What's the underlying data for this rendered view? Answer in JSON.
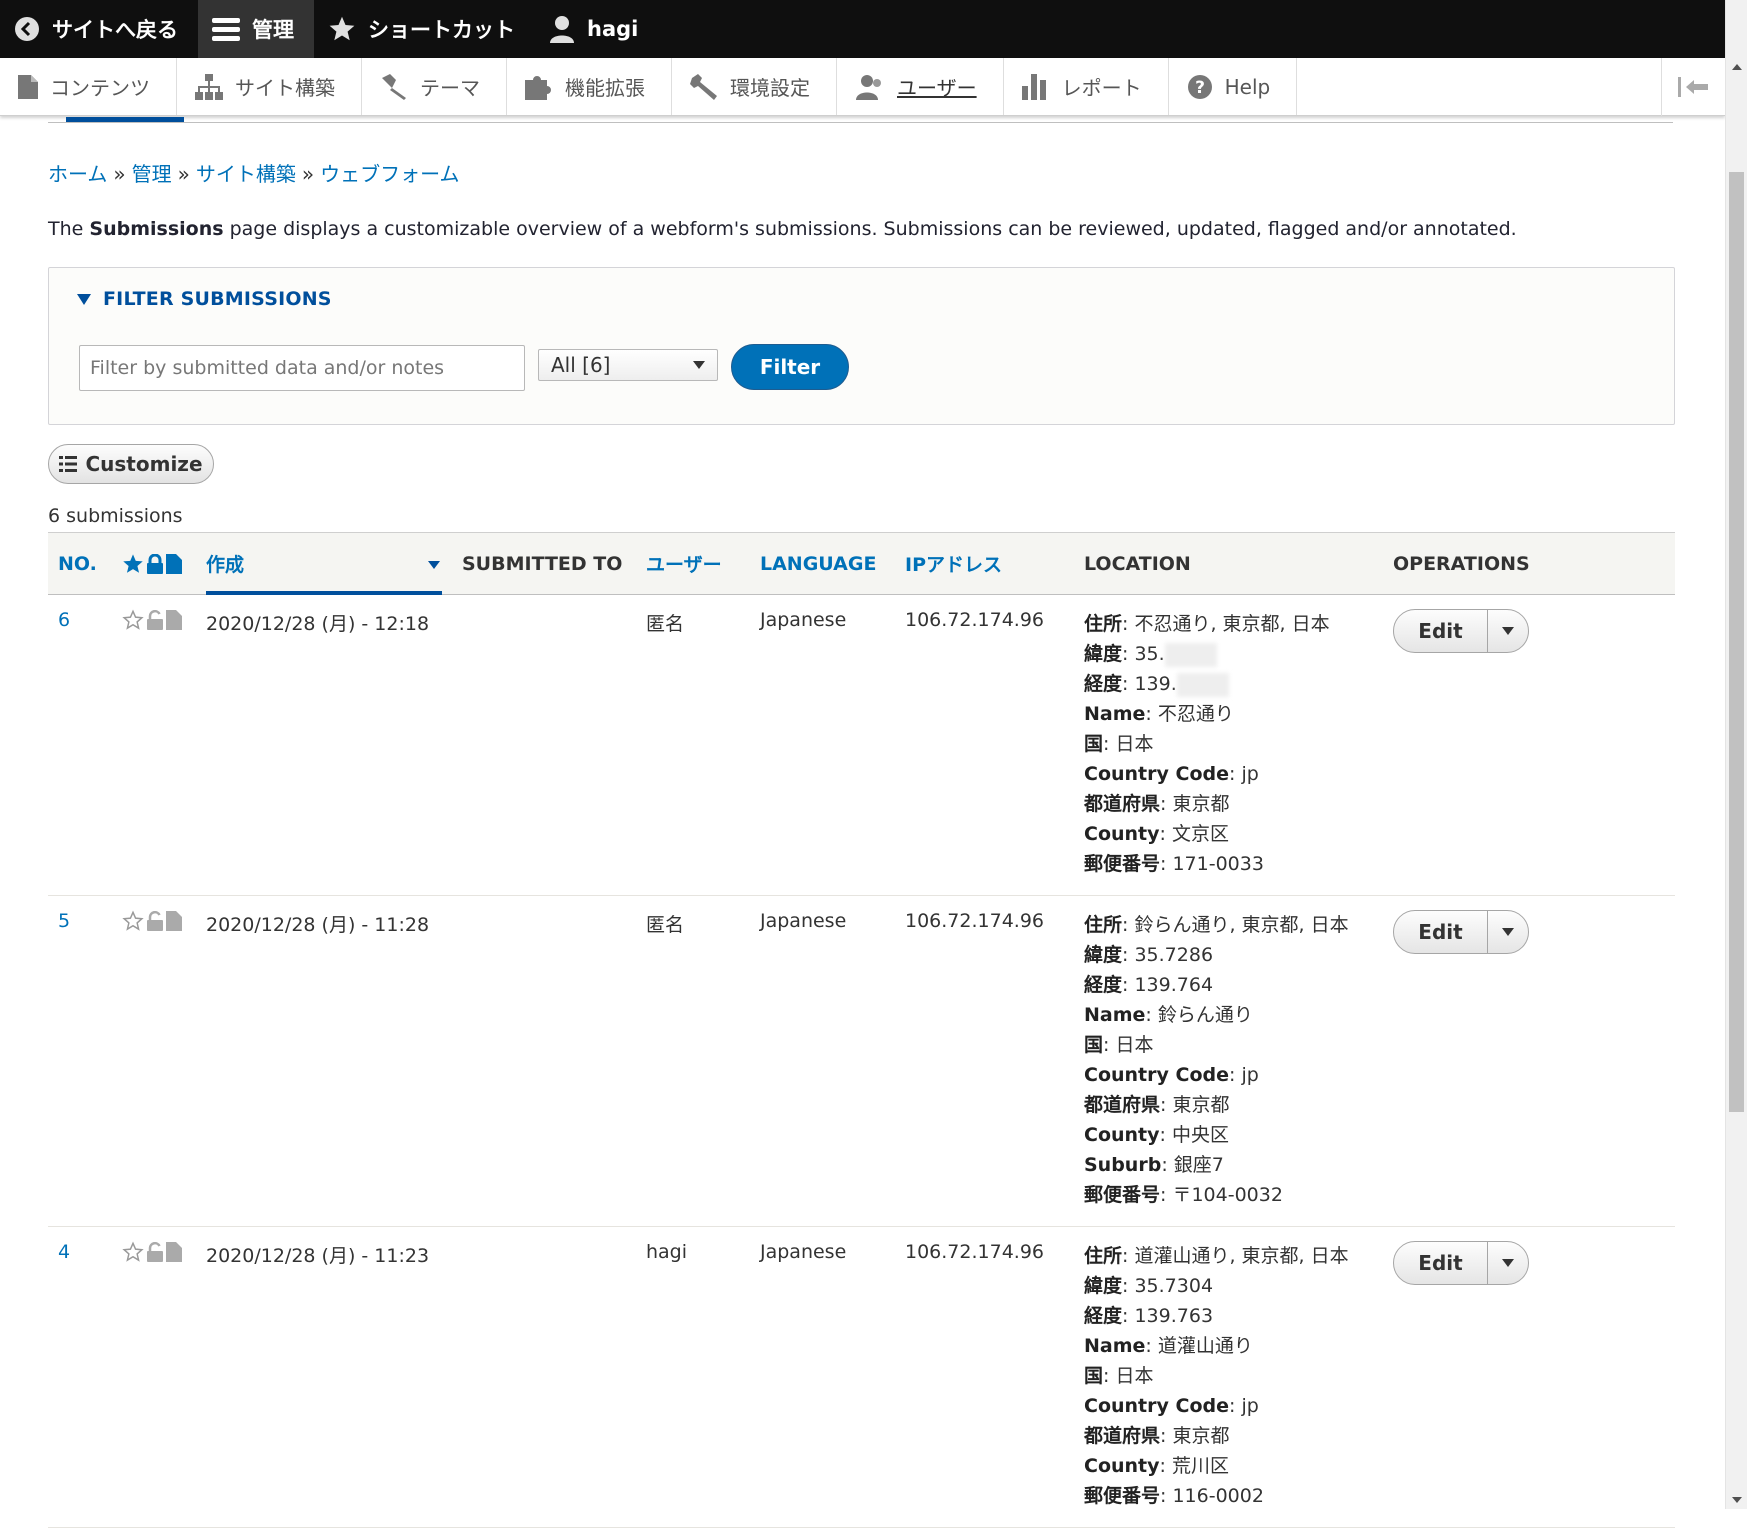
{
  "admin_bar": {
    "back": "サイトへ戻る",
    "manage": "管理",
    "shortcuts": "ショートカット",
    "user": "hagi"
  },
  "admin_tray": {
    "items": [
      {
        "label": "コンテンツ",
        "icon": "file-icon"
      },
      {
        "label": "サイト構築",
        "icon": "sitemap-icon"
      },
      {
        "label": "テーマ",
        "icon": "brush-icon"
      },
      {
        "label": "機能拡張",
        "icon": "puzzle-icon"
      },
      {
        "label": "環境設定",
        "icon": "wrench-icon"
      },
      {
        "label": "ユーザー",
        "icon": "users-icon"
      },
      {
        "label": "レポート",
        "icon": "bar-chart-icon"
      },
      {
        "label": "Help",
        "icon": "help-icon"
      }
    ]
  },
  "breadcrumb": [
    "ホーム",
    "管理",
    "サイト構築",
    "ウェブフォーム"
  ],
  "breadcrumb_separator": "»",
  "description": {
    "prefix": "The ",
    "bold": "Submissions",
    "suffix": " page displays a customizable overview of a webform's submissions. Submissions can be reviewed, updated, flagged and/or annotated."
  },
  "filter": {
    "summary": "FILTER SUBMISSIONS",
    "placeholder": "Filter by submitted data and/or notes",
    "value": "",
    "select_value": "All [6]",
    "button": "Filter"
  },
  "customize_label": "Customize",
  "count_text": "6 submissions",
  "table": {
    "headers": {
      "no": "NO.",
      "created": "作成",
      "submitted_to": "SUBMITTED TO",
      "user": "ユーザー",
      "language": "LANGUAGE",
      "ip": "IPアドレス",
      "location": "LOCATION",
      "operations": "OPERATIONS"
    },
    "rows": [
      {
        "no": "6",
        "created": "2020/12/28 (月) - 12:18",
        "submitted_to": "",
        "user": "匿名",
        "language": "Japanese",
        "ip": "106.72.174.96",
        "location": [
          {
            "key": "住所",
            "value": ": 不忍通り, 東京都, 日本"
          },
          {
            "key": "緯度",
            "value": ": 35."
          },
          {
            "key": "経度",
            "value": ": 139."
          },
          {
            "key": "Name",
            "value": ": 不忍通り"
          },
          {
            "key": "国",
            "value": ": 日本"
          },
          {
            "key": "Country Code",
            "value": ": jp"
          },
          {
            "key": "都道府県",
            "value": ": 東京都"
          },
          {
            "key": "County",
            "value": ": 文京区"
          },
          {
            "key": "郵便番号",
            "value": ": 171-0033"
          }
        ],
        "edit": "Edit"
      },
      {
        "no": "5",
        "created": "2020/12/28 (月) - 11:28",
        "submitted_to": "",
        "user": "匿名",
        "language": "Japanese",
        "ip": "106.72.174.96",
        "location": [
          {
            "key": "住所",
            "value": ": 鈴らん通り, 東京都, 日本"
          },
          {
            "key": "緯度",
            "value": ": 35.7286"
          },
          {
            "key": "経度",
            "value": ": 139.764"
          },
          {
            "key": "Name",
            "value": ": 鈴らん通り"
          },
          {
            "key": "国",
            "value": ": 日本"
          },
          {
            "key": "Country Code",
            "value": ": jp"
          },
          {
            "key": "都道府県",
            "value": ": 東京都"
          },
          {
            "key": "County",
            "value": ": 中央区"
          },
          {
            "key": "Suburb",
            "value": ": 銀座7"
          },
          {
            "key": "郵便番号",
            "value": ": 〒104-0032"
          }
        ],
        "edit": "Edit"
      },
      {
        "no": "4",
        "created": "2020/12/28 (月) - 11:23",
        "submitted_to": "",
        "user": "hagi",
        "language": "Japanese",
        "ip": "106.72.174.96",
        "location": [
          {
            "key": "住所",
            "value": ": 道灌山通り, 東京都, 日本"
          },
          {
            "key": "緯度",
            "value": ": 35.7304"
          },
          {
            "key": "経度",
            "value": ": 139.763"
          },
          {
            "key": "Name",
            "value": ": 道灌山通り"
          },
          {
            "key": "国",
            "value": ": 日本"
          },
          {
            "key": "Country Code",
            "value": ": jp"
          },
          {
            "key": "都道府県",
            "value": ": 東京都"
          },
          {
            "key": "County",
            "value": ": 荒川区"
          },
          {
            "key": "郵便番号",
            "value": ": 116-0002"
          }
        ],
        "edit": "Edit"
      }
    ]
  },
  "colors": {
    "link": "#0071b8",
    "primary_button": "#0071b8",
    "admin_bar": "#0f0f0f",
    "table_header_bg": "#f5f5f2"
  }
}
